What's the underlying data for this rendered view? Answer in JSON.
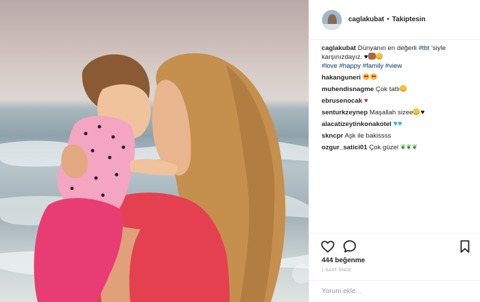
{
  "post": {
    "username": "caglakubat",
    "separator": "•",
    "follow_status": "Takiptesin",
    "caption": {
      "username": "caglakubat",
      "text_before_tag": "Dünyanın en değerli",
      "tag_tbt": "#tbt",
      "text_after_tag": "'siyle karşınızdayız.",
      "hashtags": "#love #happy #family #view"
    },
    "comments": [
      {
        "username": "hakanguneri",
        "text": "",
        "emoji": [
          "love-eyes-icon",
          "love-eyes-icon"
        ]
      },
      {
        "username": "muhendisnagme",
        "text": "Çok tatlı",
        "emoji": [
          "smile-icon"
        ]
      },
      {
        "username": "ebrusenocak",
        "text": "",
        "emoji": [
          "red-heart-icon"
        ]
      },
      {
        "username": "senturkzeynep",
        "text": "Maşallah sizee",
        "emoji": [
          "smile-icon",
          "black-heart-icon"
        ]
      },
      {
        "username": "alacatizeytinkonakotel",
        "text": "",
        "emoji": [
          "blue-heart-icon",
          "blue-heart-icon"
        ]
      },
      {
        "username": "skncpr",
        "text": "Aşk ile bakissss",
        "emoji": []
      },
      {
        "username": "ozgur_satici01",
        "text": "Çok güzel",
        "emoji": [
          "leaf-icon",
          "leaf-icon",
          "leaf-icon"
        ]
      }
    ],
    "likes_label": "444 beğenme",
    "time_label": "1 SAAT ÖNCE",
    "comment_placeholder": "Yorum ekle...",
    "colors": {
      "link": "#003569",
      "text": "#262626",
      "muted": "#999999",
      "border": "#efefef"
    }
  }
}
